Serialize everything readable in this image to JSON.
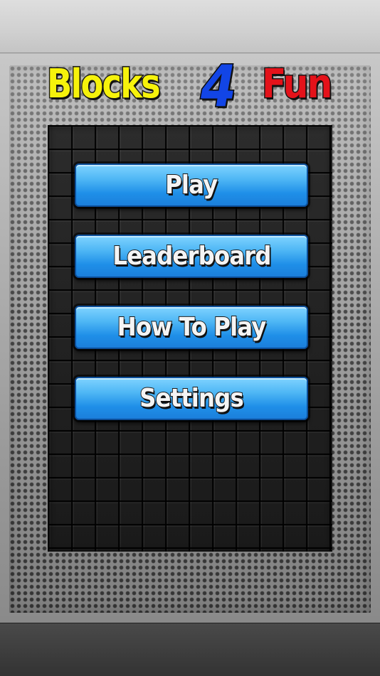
{
  "title": {
    "word1": "Blocks",
    "word2": "4",
    "word3": "Fun"
  },
  "menu": {
    "items": [
      {
        "label": "Play"
      },
      {
        "label": "Leaderboard"
      },
      {
        "label": "How To Play"
      },
      {
        "label": "Settings"
      }
    ]
  },
  "colors": {
    "title_blocks": "#f6f20b",
    "title_four": "#1245e6",
    "title_fun": "#e4121a",
    "button_blue": "#1f8fe8",
    "board_background": "#1b1b1b"
  }
}
